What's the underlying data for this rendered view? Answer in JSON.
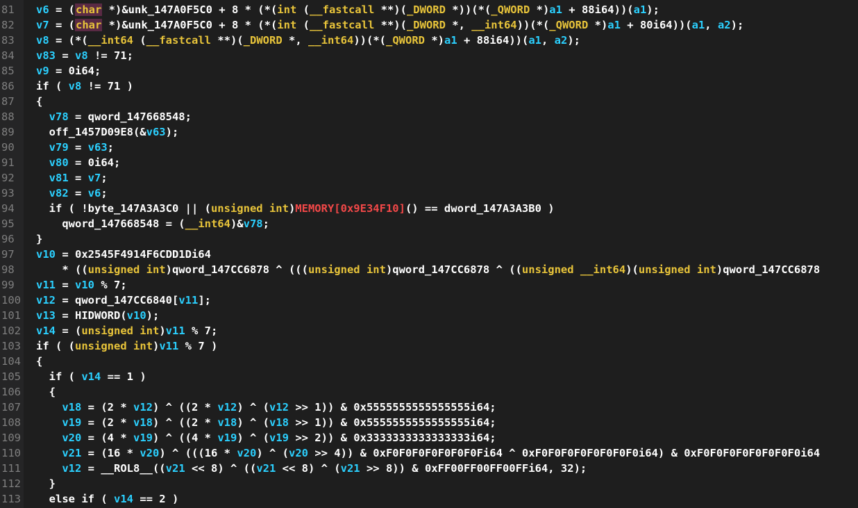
{
  "editor": {
    "colors": {
      "background": "#1e1e1e",
      "gutter": "#252526",
      "line_number": "#7f7f7f",
      "text": "#ffffff",
      "variable": "#2bd0ff",
      "type": "#e8c43a",
      "memory": "#f24848"
    },
    "lines": [
      {
        "n": "81",
        "tokens": [
          [
            "v",
            "v6"
          ],
          [
            "p",
            " = ("
          ],
          [
            "c",
            "char"
          ],
          [
            "p",
            " *)&unk_147A0F5C0 + 8 * (*("
          ],
          [
            "t",
            "int"
          ],
          [
            "p",
            " ("
          ],
          [
            "t",
            "__fastcall"
          ],
          [
            "p",
            " **)("
          ],
          [
            "t",
            "_DWORD"
          ],
          [
            "p",
            " *))(*("
          ],
          [
            "t",
            "_QWORD"
          ],
          [
            "p",
            " *)"
          ],
          [
            "v",
            "a1"
          ],
          [
            "p",
            " + 88i64))("
          ],
          [
            "v",
            "a1"
          ],
          [
            "p",
            ");"
          ]
        ]
      },
      {
        "n": "82",
        "tokens": [
          [
            "v",
            "v7"
          ],
          [
            "p",
            " = ("
          ],
          [
            "c",
            "char"
          ],
          [
            "p",
            " *)&unk_147A0F5C0 + 8 * (*("
          ],
          [
            "t",
            "int"
          ],
          [
            "p",
            " ("
          ],
          [
            "t",
            "__fastcall"
          ],
          [
            "p",
            " **)("
          ],
          [
            "t",
            "_DWORD"
          ],
          [
            "p",
            " *, "
          ],
          [
            "t",
            "__int64"
          ],
          [
            "p",
            "))(*("
          ],
          [
            "t",
            "_QWORD"
          ],
          [
            "p",
            " *)"
          ],
          [
            "v",
            "a1"
          ],
          [
            "p",
            " + 80i64))("
          ],
          [
            "v",
            "a1"
          ],
          [
            "p",
            ", "
          ],
          [
            "v",
            "a2"
          ],
          [
            "p",
            ");"
          ]
        ]
      },
      {
        "n": "83",
        "tokens": [
          [
            "v",
            "v8"
          ],
          [
            "p",
            " = (*("
          ],
          [
            "t",
            "__int64"
          ],
          [
            "p",
            " ("
          ],
          [
            "t",
            "__fastcall"
          ],
          [
            "p",
            " **)("
          ],
          [
            "t",
            "_DWORD"
          ],
          [
            "p",
            " *, "
          ],
          [
            "t",
            "__int64"
          ],
          [
            "p",
            "))(*("
          ],
          [
            "t",
            "_QWORD"
          ],
          [
            "p",
            " *)"
          ],
          [
            "v",
            "a1"
          ],
          [
            "p",
            " + 88i64))("
          ],
          [
            "v",
            "a1"
          ],
          [
            "p",
            ", "
          ],
          [
            "v",
            "a2"
          ],
          [
            "p",
            ");"
          ]
        ]
      },
      {
        "n": "84",
        "tokens": [
          [
            "v",
            "v83"
          ],
          [
            "p",
            " = "
          ],
          [
            "v",
            "v8"
          ],
          [
            "p",
            " != 71;"
          ]
        ]
      },
      {
        "n": "85",
        "tokens": [
          [
            "v",
            "v9"
          ],
          [
            "p",
            " = 0i64;"
          ]
        ]
      },
      {
        "n": "86",
        "tokens": [
          [
            "p",
            "if ( "
          ],
          [
            "v",
            "v8"
          ],
          [
            "p",
            " != 71 )"
          ]
        ]
      },
      {
        "n": "87",
        "tokens": [
          [
            "p",
            "{"
          ]
        ]
      },
      {
        "n": "88",
        "tokens": [
          [
            "p",
            "  "
          ],
          [
            "v",
            "v78"
          ],
          [
            "p",
            " = qword_147668548;"
          ]
        ]
      },
      {
        "n": "89",
        "tokens": [
          [
            "p",
            "  off_1457D09E8(&"
          ],
          [
            "v",
            "v63"
          ],
          [
            "p",
            ");"
          ]
        ]
      },
      {
        "n": "90",
        "tokens": [
          [
            "p",
            "  "
          ],
          [
            "v",
            "v79"
          ],
          [
            "p",
            " = "
          ],
          [
            "v",
            "v63"
          ],
          [
            "p",
            ";"
          ]
        ]
      },
      {
        "n": "91",
        "tokens": [
          [
            "p",
            "  "
          ],
          [
            "v",
            "v80"
          ],
          [
            "p",
            " = 0i64;"
          ]
        ]
      },
      {
        "n": "92",
        "tokens": [
          [
            "p",
            "  "
          ],
          [
            "v",
            "v81"
          ],
          [
            "p",
            " = "
          ],
          [
            "v",
            "v7"
          ],
          [
            "p",
            ";"
          ]
        ]
      },
      {
        "n": "93",
        "tokens": [
          [
            "p",
            "  "
          ],
          [
            "v",
            "v82"
          ],
          [
            "p",
            " = "
          ],
          [
            "v",
            "v6"
          ],
          [
            "p",
            ";"
          ]
        ]
      },
      {
        "n": "94",
        "tokens": [
          [
            "p",
            "  if ( !byte_147A3A3C0 || ("
          ],
          [
            "t",
            "unsigned int"
          ],
          [
            "p",
            ")"
          ],
          [
            "m",
            "MEMORY[0x9E34F10]"
          ],
          [
            "p",
            "() == dword_147A3A3B0 )"
          ]
        ]
      },
      {
        "n": "95",
        "tokens": [
          [
            "p",
            "    qword_147668548 = ("
          ],
          [
            "t",
            "__int64"
          ],
          [
            "p",
            ")&"
          ],
          [
            "v",
            "v78"
          ],
          [
            "p",
            ";"
          ]
        ]
      },
      {
        "n": "96",
        "tokens": [
          [
            "p",
            "}"
          ]
        ]
      },
      {
        "n": "97",
        "tokens": [
          [
            "v",
            "v10"
          ],
          [
            "p",
            " = 0x2545F4914F6CDD1Di64"
          ]
        ]
      },
      {
        "n": "98",
        "tokens": [
          [
            "p",
            "    * (("
          ],
          [
            "t",
            "unsigned int"
          ],
          [
            "p",
            ")qword_147CC6878 ^ ((("
          ],
          [
            "t",
            "unsigned int"
          ],
          [
            "p",
            ")qword_147CC6878 ^ (("
          ],
          [
            "t",
            "unsigned __int64"
          ],
          [
            "p",
            ")("
          ],
          [
            "t",
            "unsigned int"
          ],
          [
            "p",
            ")qword_147CC6878"
          ]
        ]
      },
      {
        "n": "99",
        "tokens": [
          [
            "v",
            "v11"
          ],
          [
            "p",
            " = "
          ],
          [
            "v",
            "v10"
          ],
          [
            "p",
            " % 7;"
          ]
        ]
      },
      {
        "n": "100",
        "tokens": [
          [
            "v",
            "v12"
          ],
          [
            "p",
            " = qword_147CC6840["
          ],
          [
            "v",
            "v11"
          ],
          [
            "p",
            "];"
          ]
        ]
      },
      {
        "n": "101",
        "tokens": [
          [
            "v",
            "v13"
          ],
          [
            "p",
            " = HIDWORD("
          ],
          [
            "v",
            "v10"
          ],
          [
            "p",
            ");"
          ]
        ]
      },
      {
        "n": "102",
        "tokens": [
          [
            "v",
            "v14"
          ],
          [
            "p",
            " = ("
          ],
          [
            "t",
            "unsigned int"
          ],
          [
            "p",
            ")"
          ],
          [
            "v",
            "v11"
          ],
          [
            "p",
            " % 7;"
          ]
        ]
      },
      {
        "n": "103",
        "tokens": [
          [
            "p",
            "if ( ("
          ],
          [
            "t",
            "unsigned int"
          ],
          [
            "p",
            ")"
          ],
          [
            "v",
            "v11"
          ],
          [
            "p",
            " % 7 )"
          ]
        ]
      },
      {
        "n": "104",
        "tokens": [
          [
            "p",
            "{"
          ]
        ]
      },
      {
        "n": "105",
        "tokens": [
          [
            "p",
            "  if ( "
          ],
          [
            "v",
            "v14"
          ],
          [
            "p",
            " == 1 )"
          ]
        ]
      },
      {
        "n": "106",
        "tokens": [
          [
            "p",
            "  {"
          ]
        ]
      },
      {
        "n": "107",
        "tokens": [
          [
            "p",
            "    "
          ],
          [
            "v",
            "v18"
          ],
          [
            "p",
            " = (2 * "
          ],
          [
            "v",
            "v12"
          ],
          [
            "p",
            ") ^ ((2 * "
          ],
          [
            "v",
            "v12"
          ],
          [
            "p",
            ") ^ ("
          ],
          [
            "v",
            "v12"
          ],
          [
            "p",
            " >> 1)) & 0x5555555555555555i64;"
          ]
        ]
      },
      {
        "n": "108",
        "tokens": [
          [
            "p",
            "    "
          ],
          [
            "v",
            "v19"
          ],
          [
            "p",
            " = (2 * "
          ],
          [
            "v",
            "v18"
          ],
          [
            "p",
            ") ^ ((2 * "
          ],
          [
            "v",
            "v18"
          ],
          [
            "p",
            ") ^ ("
          ],
          [
            "v",
            "v18"
          ],
          [
            "p",
            " >> 1)) & 0x5555555555555555i64;"
          ]
        ]
      },
      {
        "n": "109",
        "tokens": [
          [
            "p",
            "    "
          ],
          [
            "v",
            "v20"
          ],
          [
            "p",
            " = (4 * "
          ],
          [
            "v",
            "v19"
          ],
          [
            "p",
            ") ^ ((4 * "
          ],
          [
            "v",
            "v19"
          ],
          [
            "p",
            ") ^ ("
          ],
          [
            "v",
            "v19"
          ],
          [
            "p",
            " >> 2)) & 0x3333333333333333i64;"
          ]
        ]
      },
      {
        "n": "110",
        "tokens": [
          [
            "p",
            "    "
          ],
          [
            "v",
            "v21"
          ],
          [
            "p",
            " = (16 * "
          ],
          [
            "v",
            "v20"
          ],
          [
            "p",
            ") ^ (((16 * "
          ],
          [
            "v",
            "v20"
          ],
          [
            "p",
            ") ^ ("
          ],
          [
            "v",
            "v20"
          ],
          [
            "p",
            " >> 4)) & 0xF0F0F0F0F0F0F0Fi64 ^ 0xF0F0F0F0F0F0F0F0i64) & 0xF0F0F0F0F0F0F0F0i64"
          ]
        ]
      },
      {
        "n": "111",
        "tokens": [
          [
            "p",
            "    "
          ],
          [
            "v",
            "v12"
          ],
          [
            "p",
            " = __ROL8__(("
          ],
          [
            "v",
            "v21"
          ],
          [
            "p",
            " << 8) ^ (("
          ],
          [
            "v",
            "v21"
          ],
          [
            "p",
            " << 8) ^ ("
          ],
          [
            "v",
            "v21"
          ],
          [
            "p",
            " >> 8)) & 0xFF00FF00FF00FFi64, 32);"
          ]
        ]
      },
      {
        "n": "112",
        "tokens": [
          [
            "p",
            "  }"
          ]
        ]
      },
      {
        "n": "113",
        "tokens": [
          [
            "p",
            "  else if ( "
          ],
          [
            "v",
            "v14"
          ],
          [
            "p",
            " == 2 )"
          ]
        ]
      }
    ]
  }
}
